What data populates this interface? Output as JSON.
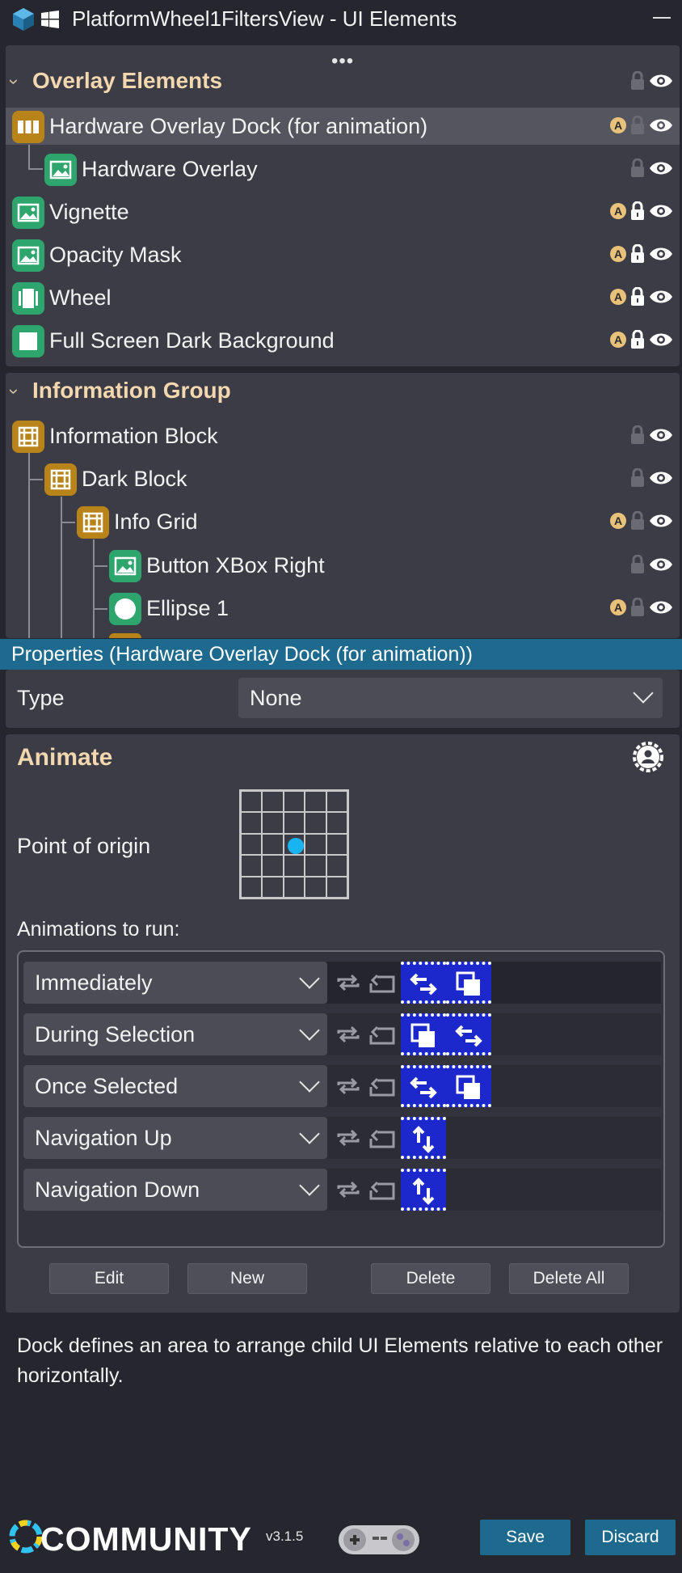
{
  "window": {
    "title": "PlatformWheel1FiltersView - UI Elements"
  },
  "groups": [
    {
      "title": "Overlay Elements",
      "rows": [
        {
          "label": "Hardware Overlay Dock (for animation)",
          "icon": "dock-icon",
          "selected": true
        },
        {
          "label": "Hardware Overlay",
          "icon": "image-icon"
        },
        {
          "label": "Vignette",
          "icon": "image-icon"
        },
        {
          "label": "Opacity Mask",
          "icon": "image-icon"
        },
        {
          "label": "Wheel",
          "icon": "wheel-icon"
        },
        {
          "label": "Full Screen Dark Background",
          "icon": "rectangle-icon"
        }
      ]
    },
    {
      "title": "Information Group",
      "rows": [
        {
          "label": "Information Block",
          "icon": "grid-icon"
        },
        {
          "label": "Dark Block",
          "icon": "grid-icon"
        },
        {
          "label": "Info Grid",
          "icon": "grid-icon"
        },
        {
          "label": "Button XBox Right",
          "icon": "image-icon"
        },
        {
          "label": "Ellipse 1",
          "icon": "ellipse-icon"
        }
      ]
    }
  ],
  "properties": {
    "header": "Properties (Hardware Overlay Dock (for animation))",
    "type_label": "Type",
    "type_value": "None"
  },
  "animate": {
    "title": "Animate",
    "origin_label": "Point of origin",
    "animations_label": "Animations to run:",
    "rows": [
      {
        "trigger": "Immediately"
      },
      {
        "trigger": "During Selection"
      },
      {
        "trigger": "Once Selected"
      },
      {
        "trigger": "Navigation Up"
      },
      {
        "trigger": "Navigation Down"
      }
    ],
    "buttons": {
      "edit": "Edit",
      "new": "New",
      "delete": "Delete",
      "delete_all": "Delete All"
    }
  },
  "description": "Dock defines an area to arrange child UI Elements relative to each other horizontally.",
  "footer": {
    "logo": "COMMUNITY",
    "version": "v3.1.5",
    "save": "Save",
    "discard": "Discard"
  },
  "colors": {
    "accent": "#1e6a8e",
    "group_title": "#f3d7ae",
    "origin_dot": "#18b4f0",
    "icon_green": "#2fa56e",
    "icon_gold": "#b88318"
  }
}
